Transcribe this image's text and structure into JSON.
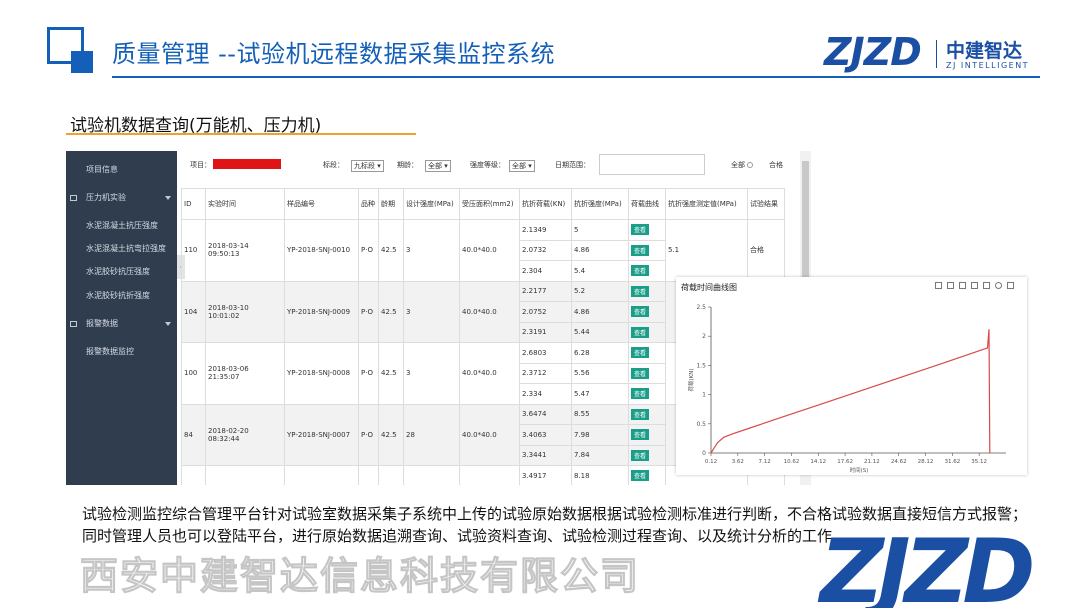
{
  "header": {
    "title": "质量管理 --试验机远程数据采集监控系统",
    "brand_mark": "ZJZD",
    "brand_cn": "中建智达",
    "brand_en": "ZJ INTELLIGENT"
  },
  "section_title": "试验机数据查询(万能机、压力机)",
  "sidebar": {
    "items": [
      {
        "label": "项目信息"
      },
      {
        "label": "压力机实验"
      },
      {
        "label": "水泥混凝土抗压强度"
      },
      {
        "label": "水泥混凝土抗弯拉强度"
      },
      {
        "label": "水泥胶砂抗压强度"
      },
      {
        "label": "水泥胶砂抗折强度"
      },
      {
        "label": "报警数据"
      },
      {
        "label": "报警数据监控"
      }
    ]
  },
  "filters": {
    "project_label": "项目：",
    "section_label": "标段：",
    "section_value": "九标段",
    "age_label": "期龄：",
    "age_value": "全部",
    "grade_label": "强度等级：",
    "grade_value": "全部",
    "date_label": "日期范围：",
    "all_label": "全部",
    "pass_label": "合格"
  },
  "table": {
    "headers": [
      "ID",
      "实验时间",
      "样品编号",
      "品种",
      "龄期",
      "设计强度(MPa)",
      "受压面积(mm2)",
      "抗折荷载(KN)",
      "抗折强度(MPa)",
      "荷载曲线",
      "抗折强度测定值(MPa)",
      "试验结果"
    ],
    "view_label": "查看",
    "groups": [
      {
        "id": "110",
        "time": "2018-03-14 09:50:13",
        "sample": "YP-2018-SNJ-0010",
        "kind": "P·O",
        "age": "42.5",
        "design": "3",
        "area": "40.0*40.0",
        "loads": [
          "2.1349",
          "2.0732",
          "2.304"
        ],
        "strengths": [
          "5",
          "4.86",
          "5.4"
        ],
        "measured": "5.1",
        "result": "合格"
      },
      {
        "id": "104",
        "time": "2018-03-10 10:01:02",
        "sample": "YP-2018-SNJ-0009",
        "kind": "P·O",
        "age": "42.5",
        "design": "3",
        "area": "40.0*40.0",
        "loads": [
          "2.2177",
          "2.0752",
          "2.3191"
        ],
        "strengths": [
          "5.2",
          "4.86",
          "5.44"
        ],
        "measured": "",
        "result": ""
      },
      {
        "id": "100",
        "time": "2018-03-06 21:35:07",
        "sample": "YP-2018-SNJ-0008",
        "kind": "P·O",
        "age": "42.5",
        "design": "3",
        "area": "40.0*40.0",
        "loads": [
          "2.6803",
          "2.3712",
          "2.334"
        ],
        "strengths": [
          "6.28",
          "5.56",
          "5.47"
        ],
        "measured": "",
        "result": ""
      },
      {
        "id": "84",
        "time": "2018-02-20 08:32:44",
        "sample": "YP-2018-SNJ-0007",
        "kind": "P·O",
        "age": "42.5",
        "design": "28",
        "area": "40.0*40.0",
        "loads": [
          "3.6474",
          "3.4063",
          "3.3441"
        ],
        "strengths": [
          "8.55",
          "7.98",
          "7.84"
        ],
        "measured": "",
        "result": ""
      },
      {
        "id": "",
        "time": "",
        "sample": "",
        "kind": "",
        "age": "",
        "design": "",
        "area": "",
        "loads": [
          "3.4917"
        ],
        "strengths": [
          "8.18"
        ],
        "measured": "",
        "result": ""
      }
    ]
  },
  "chart_popup": {
    "title": "荷载时间曲线图"
  },
  "chart_data": {
    "type": "line",
    "ylabel": "荷载(KN)",
    "xlabel": "时间(S)",
    "x_ticks": [
      "0.12",
      "3.62",
      "7.12",
      "10.62",
      "14.12",
      "17.62",
      "21.12",
      "24.62",
      "28.12",
      "31.62",
      "35.12"
    ],
    "y_ticks": [
      "0",
      "0.5",
      "1",
      "1.5",
      "2",
      "2.5"
    ],
    "xlim": [
      0.12,
      38.62
    ],
    "ylim": [
      0,
      2.5
    ],
    "grid": false,
    "series": [
      {
        "color": "#d94a4a",
        "x": [
          0.12,
          0.5,
          1.0,
          1.8,
          3.0,
          5.0,
          10.0,
          15.0,
          20.0,
          25.0,
          30.0,
          34.0,
          36.2,
          36.4,
          36.5
        ],
        "y": [
          0.0,
          0.08,
          0.18,
          0.27,
          0.33,
          0.42,
          0.64,
          0.86,
          1.08,
          1.3,
          1.52,
          1.7,
          1.8,
          2.12,
          0.0
        ]
      }
    ]
  },
  "paragraph": "试验检测监控综合管理平台针对试验室数据采集子系统中上传的试验原始数据根据试验检测标准进行判断，不合格试验数据直接短信方式报警；同时管理人员也可以登陆平台，进行原始数据追溯查询、试验资料查询、试验检测过程查询、以及统计分析的工作。",
  "watermark": {
    "company": "西安中建智达信息科技有限公司",
    "logo": "ZJZD"
  },
  "colors": {
    "brand_blue": "#1460b8",
    "accent_orange": "#f0a030",
    "view_green": "#1a9e8a",
    "chart_red": "#d94a4a"
  }
}
